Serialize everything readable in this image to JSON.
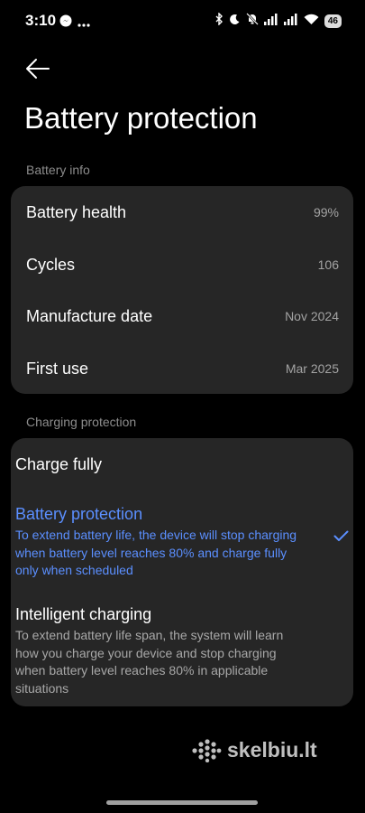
{
  "status": {
    "time": "3:10",
    "battery": "46",
    "icons": [
      "messenger-icon",
      "more-icon",
      "bluetooth-icon",
      "moon-icon",
      "notifications-off-icon",
      "signal-icon",
      "signal-icon",
      "wifi-icon"
    ]
  },
  "header": {
    "title": "Battery protection"
  },
  "battery_info": {
    "section_label": "Battery info",
    "rows": [
      {
        "label": "Battery health",
        "value": "99%"
      },
      {
        "label": "Cycles",
        "value": "106"
      },
      {
        "label": "Manufacture date",
        "value": "Nov 2024"
      },
      {
        "label": "First use",
        "value": "Mar 2025"
      }
    ]
  },
  "charging": {
    "section_label": "Charging protection",
    "options": [
      {
        "title": "Charge fully",
        "desc": "",
        "selected": false
      },
      {
        "title": "Battery protection",
        "desc": "To extend battery life, the device will stop charging when battery level reaches 80% and charge fully only when scheduled",
        "selected": true
      },
      {
        "title": "Intelligent charging",
        "desc": "To extend battery life span, the system will learn how you charge your device and stop charging when battery level reaches 80% in applicable situations",
        "selected": false
      }
    ]
  },
  "watermark": "skelbiu.lt",
  "accent_color": "#5b8fff"
}
